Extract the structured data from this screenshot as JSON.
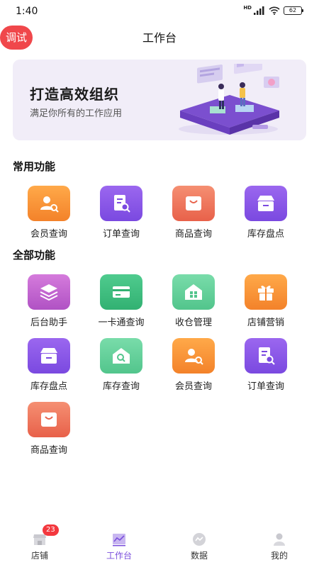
{
  "status_bar": {
    "time": "1:40",
    "network": "HD",
    "battery": "62"
  },
  "header": {
    "title": "工作台",
    "debug_badge": "调试"
  },
  "banner": {
    "title": "打造高效组织",
    "subtitle": "满足你所有的工作应用"
  },
  "common_section": {
    "title": "常用功能",
    "items": [
      {
        "label": "会员查询",
        "icon": "member-search-icon",
        "color": "#f3822a"
      },
      {
        "label": "订单查询",
        "icon": "order-search-icon",
        "color": "#7a49e0"
      },
      {
        "label": "商品查询",
        "icon": "shopping-bag-icon",
        "color": "#e8614a"
      },
      {
        "label": "库存盘点",
        "icon": "inventory-box-icon",
        "color": "#7a49e0"
      }
    ]
  },
  "all_section": {
    "title": "全部功能",
    "items": [
      {
        "label": "后台助手",
        "icon": "layers-icon",
        "color": "#b052c4"
      },
      {
        "label": "一卡通查询",
        "icon": "card-icon",
        "color": "#32b172"
      },
      {
        "label": "收仓管理",
        "icon": "warehouse-icon",
        "color": "#52c58c"
      },
      {
        "label": "店铺营销",
        "icon": "gift-icon",
        "color": "#f3822a"
      },
      {
        "label": "库存盘点",
        "icon": "inventory-box-icon",
        "color": "#7a49e0"
      },
      {
        "label": "库存查询",
        "icon": "house-search-icon",
        "color": "#52c58c"
      },
      {
        "label": "会员查询",
        "icon": "member-search-icon",
        "color": "#f3822a"
      },
      {
        "label": "订单查询",
        "icon": "order-search-icon",
        "color": "#7a49e0"
      },
      {
        "label": "商品查询",
        "icon": "shopping-bag-icon",
        "color": "#e8614a"
      }
    ]
  },
  "tab_bar": {
    "tabs": [
      {
        "label": "店铺",
        "icon": "store-icon",
        "badge": "23"
      },
      {
        "label": "工作台",
        "icon": "chart-icon",
        "active": true
      },
      {
        "label": "数据",
        "icon": "data-icon"
      },
      {
        "label": "我的",
        "icon": "profile-icon"
      }
    ]
  }
}
